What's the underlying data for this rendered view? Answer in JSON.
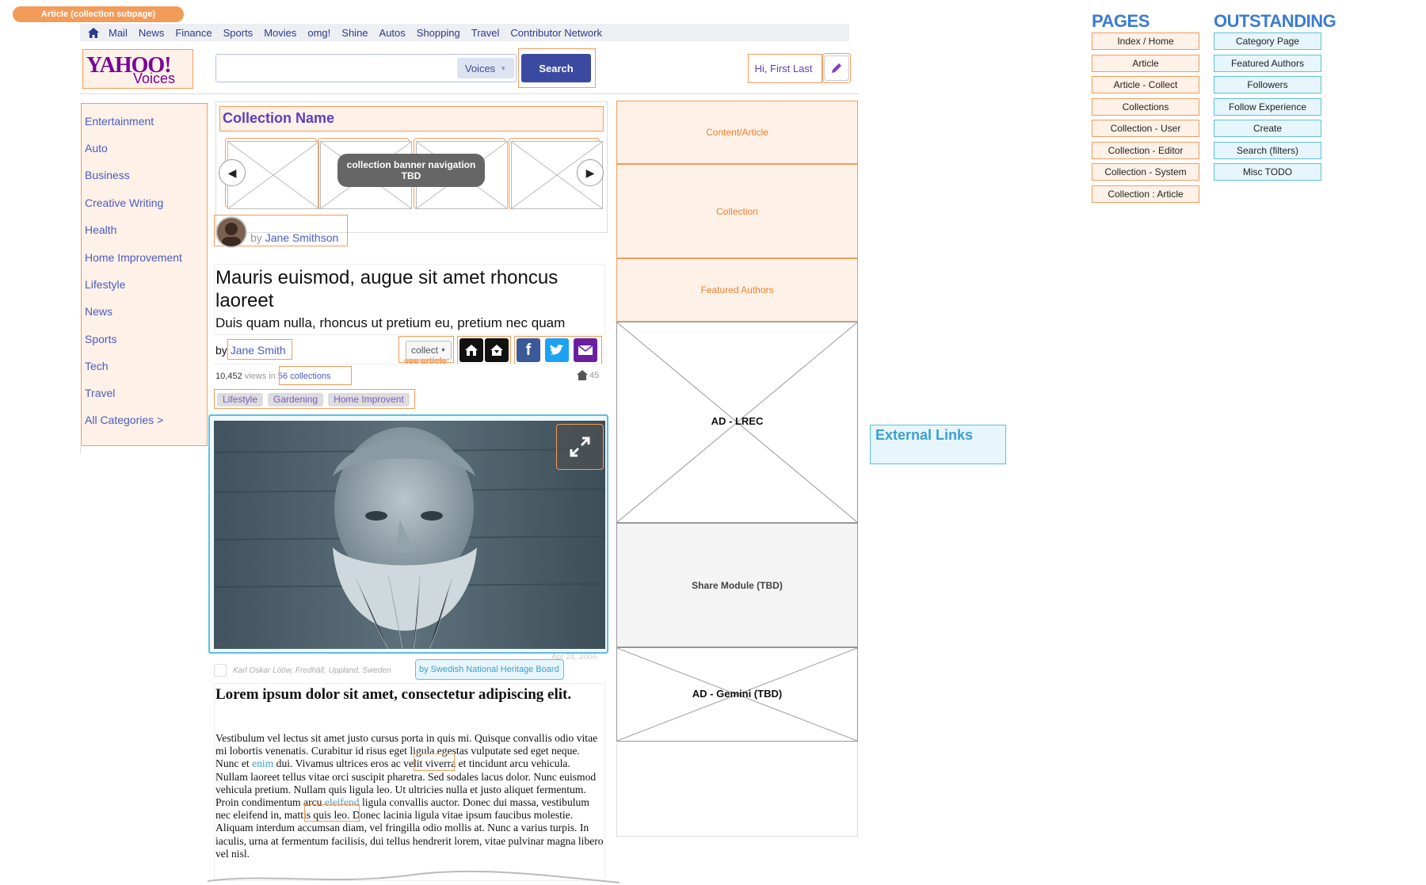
{
  "page_label": "Article (collection subpage)",
  "topnav": [
    "Mail",
    "News",
    "Finance",
    "Sports",
    "Movies",
    "omg!",
    "Shine",
    "Autos",
    "Shopping",
    "Travel",
    "Contributor Network"
  ],
  "logo": {
    "brand": "YAHOO!",
    "sub": "Voices"
  },
  "search": {
    "scope": "Voices",
    "button": "Search",
    "value": ""
  },
  "user": {
    "greeting": "Hi, First Last"
  },
  "sidebar": [
    "Entertainment",
    "Auto",
    "Business",
    "Creative Writing",
    "Health",
    "Home Improvement",
    "Lifestyle",
    "News",
    "Sports",
    "Tech",
    "Travel",
    "All Categories >"
  ],
  "collection": {
    "name": "Collection Name",
    "banner_note_line1": "collection banner navigation",
    "banner_note_line2": "TBD",
    "by": "by",
    "author": "Jane Smithson"
  },
  "article": {
    "title": "Mauris euismod, augue sit amet rhoncus laoreet",
    "subtitle": "Duis quam nulla, rhoncus ut pretium eu, pretium nec quam",
    "by": "by",
    "author": "Jane Smith",
    "collect": "collect",
    "see_article": "see article",
    "views": "10,452",
    "views_label": "views in",
    "collections": "56 collections",
    "count": "45",
    "tags": [
      "Lifestyle",
      "Gardening",
      "Home Improvent"
    ],
    "caption": "Karl Oskar Lööw, Fredhäll, Uppland, Sweden",
    "date": "Apr 24, 2006",
    "credit": "by Swedish National Heritage Board",
    "body_heading": "Lorem ipsum dolor sit amet, consectetur adipiscing elit.",
    "body_p1": " Vestibulum vel lectus sit amet justo cursus porta in quis mi. Quisque convallis odio vitae mi lobortis venenatis. Curabitur id risus eget ligula egestas vulputate sed eget neque. Nunc et ",
    "link1": "enim",
    "body_p2": " dui. Vivamus ultrices eros ac velit viverra et tincidunt arcu vehicula. Nullam laoreet tellus vitae orci suscipit pharetra. Sed sodales lacus dolor. Nunc euismod vehicula pretium. Nullam quis ligula leo. Ut ultricies nulla et justo aliquet fermentum. Proin condimentum arcu ",
    "link2": "eleifend",
    "body_p3": " ligula convallis auctor. Donec dui massa, vestibulum nec eleifend in, mattis quis leo. Donec lacinia ligula vitae ipsum faucibus molestie. Aliquam interdum accumsan diam, vel fringilla odio mollis at. Nunc a varius turpis. In iaculis, urna at fermentum facilisis, dui tellus hendrerit lorem, vitae pulvinar magna libero vel nisl."
  },
  "right_col": {
    "content": "Content/Article",
    "collection": "Collection",
    "featured": "Featured Authors",
    "ad_lrec": "AD - LREC",
    "share": "Share Module (TBD)",
    "ad_gemini": "AD - Gemini (TBD)"
  },
  "external_links": "External Links",
  "pages": {
    "title": "PAGES",
    "items": [
      "Index / Home",
      "Article",
      "Article - Collect",
      "Collections",
      "Collection - User",
      "Collection - Editor",
      "Collection - System",
      "Collection : Article"
    ]
  },
  "outstanding": {
    "title": "OUTSTANDING",
    "items": [
      "Category Page",
      "Featured Authors",
      "Followers",
      "Follow Experience",
      "Create",
      "Search (filters)",
      "Misc TODO"
    ]
  },
  "colors": {
    "annotation": "#f39c5a",
    "link_annotation": "#5bc0de",
    "brand": "#7b0099",
    "link": "#4a5cc0",
    "heading_blue": "#3a7bd5"
  }
}
